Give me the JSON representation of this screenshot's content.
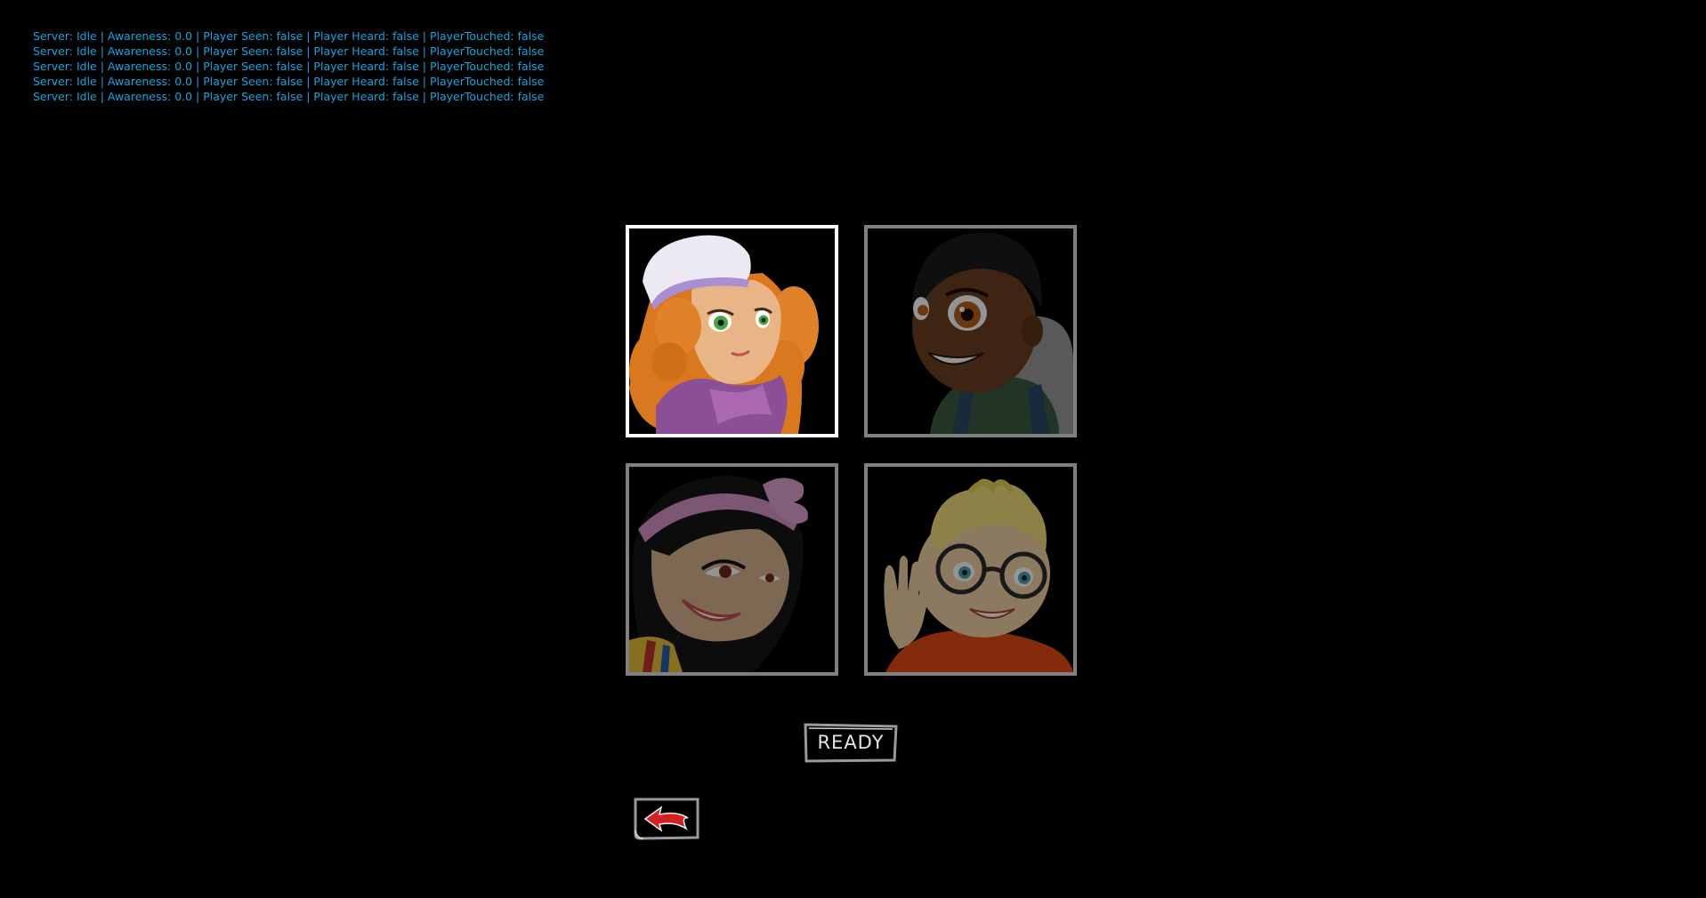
{
  "debug_overlay": {
    "lines": [
      "Server: Idle | Awareness:  0.0 | Player Seen:  false | Player Heard:  false | PlayerTouched: false",
      "Server: Idle | Awareness:  0.0 | Player Seen:  false | Player Heard:  false | PlayerTouched: false",
      "Server: Idle | Awareness:  0.0 | Player Seen:  false | Player Heard:  false | PlayerTouched: false",
      "Server: Idle | Awareness:  0.0 | Player Seen:  false | Player Heard:  false | PlayerTouched: false",
      "Server: Idle | Awareness:  0.0 | Player Seen:  false | Player Heard:  false | PlayerTouched: false"
    ],
    "color": "#18a4dc"
  },
  "character_select": {
    "selected_index": 0,
    "characters": [
      {
        "icon": "girl-orange-hair-white-beanie-portrait",
        "selected": true
      },
      {
        "icon": "boy-dark-skin-backpack-portrait",
        "selected": false
      },
      {
        "icon": "girl-black-hair-pink-headband-portrait",
        "selected": false
      },
      {
        "icon": "boy-blonde-glasses-waving-portrait",
        "selected": false
      }
    ],
    "colors": {
      "selected_border": "#ffffff",
      "unselected_border": "#808080",
      "background": "#000000"
    }
  },
  "buttons": {
    "ready_label": "READY",
    "back_icon": "red-back-arrow-icon",
    "back_arrow_color": "#d42020"
  }
}
